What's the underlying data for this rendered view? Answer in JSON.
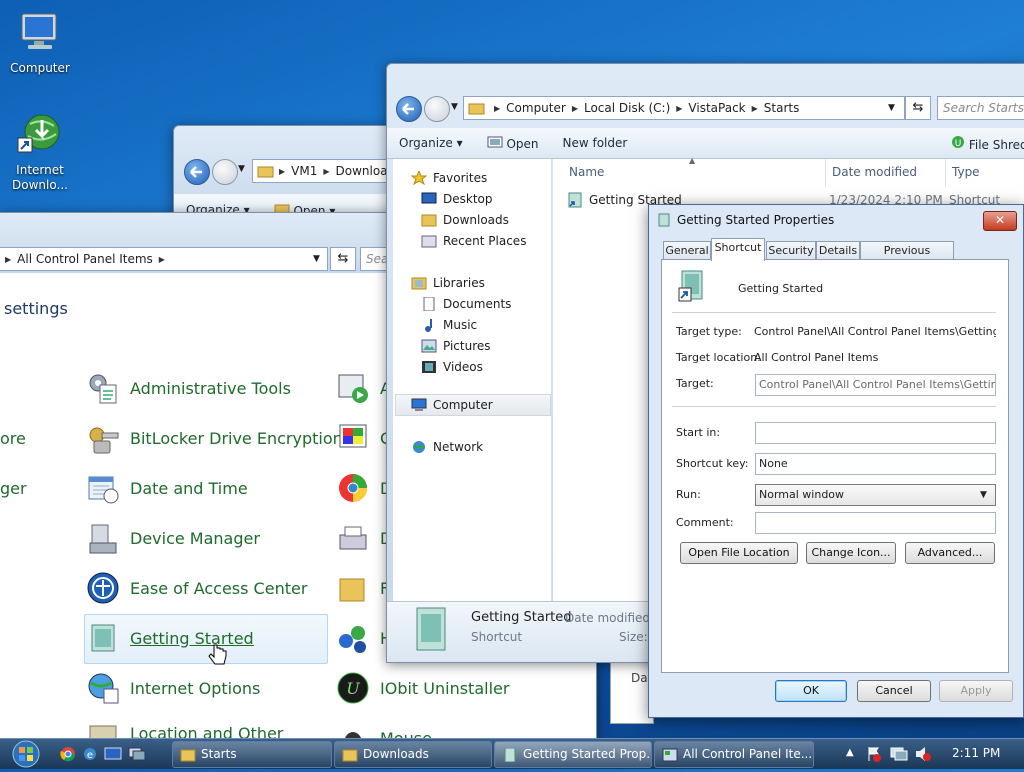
{
  "desktop": {
    "icons": [
      {
        "label": "Computer"
      },
      {
        "label": "Internet Downlo..."
      }
    ]
  },
  "downloads_window": {
    "path": [
      "VM1",
      "Downloa"
    ],
    "toolbar": {
      "organize": "Organize",
      "open": "Open"
    }
  },
  "control_panel": {
    "path": [
      "All Control Panel Items"
    ],
    "search_placeholder": "Sea",
    "heading": "settings",
    "left_partials": [
      "ore",
      "ger"
    ],
    "items": [
      {
        "label": "Administrative Tools"
      },
      {
        "label": "BitLocker Drive Encryption"
      },
      {
        "label": "Date and Time"
      },
      {
        "label": "Device Manager"
      },
      {
        "label": "Ease of Access Center"
      },
      {
        "label": "Getting Started"
      },
      {
        "label": "Internet Options"
      },
      {
        "label": "Location and Other"
      }
    ],
    "right_items": [
      {
        "label": "A"
      },
      {
        "label": "C"
      },
      {
        "label": "D"
      },
      {
        "label": "D"
      },
      {
        "label": "F"
      },
      {
        "label": "H"
      },
      {
        "label": "IObit Uninstaller"
      },
      {
        "label": "Mouse"
      }
    ]
  },
  "explorer": {
    "path": [
      "Computer",
      "Local Disk (C:)",
      "VistaPack",
      "Starts"
    ],
    "search_placeholder": "Search Starts",
    "toolbar": {
      "organize": "Organize",
      "open": "Open",
      "new_folder": "New folder",
      "extra": "File Shredd"
    },
    "columns": {
      "name": "Name",
      "date": "Date modified",
      "type": "Type"
    },
    "file_row": {
      "name": "Getting Started",
      "date": "1/23/2024 2:10 PM",
      "type": "Shortcut"
    },
    "nav": {
      "favorites": "Favorites",
      "desktop": "Desktop",
      "downloads": "Downloads",
      "recent": "Recent Places",
      "libraries": "Libraries",
      "documents": "Documents",
      "music": "Music",
      "pictures": "Pictures",
      "videos": "Videos",
      "computer": "Computer",
      "network": "Network"
    },
    "details": {
      "name": "Getting Started",
      "type": "Shortcut",
      "date_label": "Date modified:",
      "size_label": "Size:",
      "behind_label": "Dat"
    }
  },
  "dialog": {
    "title": "Getting Started Properties",
    "close": "✕",
    "tabs": [
      "General",
      "Shortcut",
      "Security",
      "Details",
      "Previous Versions"
    ],
    "name": "Getting Started",
    "target_type_label": "Target type:",
    "target_type": "Control Panel\\All Control Panel Items\\Getting Starte",
    "target_location_label": "Target location:",
    "target_location": "All Control Panel Items",
    "target_label": "Target:",
    "target": "Control Panel\\All Control Panel Items\\Getting Star",
    "start_in_label": "Start in:",
    "start_in": "",
    "shortcut_key_label": "Shortcut key:",
    "shortcut_key": "None",
    "run_label": "Run:",
    "run": "Normal window",
    "comment_label": "Comment:",
    "comment": "",
    "buttons": {
      "open_location": "Open File Location",
      "change_icon": "Change Icon...",
      "advanced": "Advanced...",
      "ok": "OK",
      "cancel": "Cancel",
      "apply": "Apply"
    }
  },
  "taskbar": {
    "tasks": [
      "Starts",
      "Downloads",
      "Getting Started Prop...",
      "All Control Panel Ite..."
    ],
    "time": "2:11 PM"
  }
}
